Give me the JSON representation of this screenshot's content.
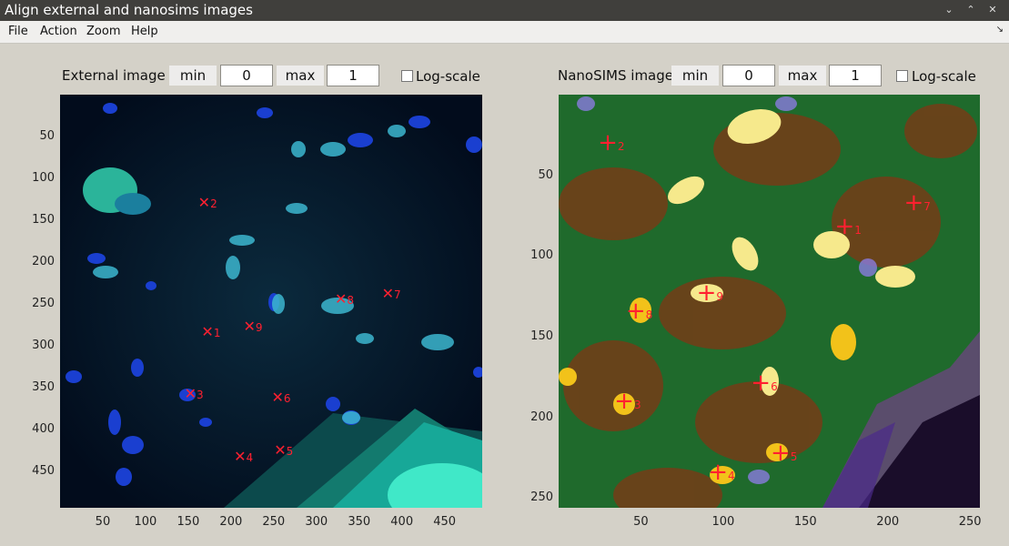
{
  "window": {
    "title": "Align external and nanosims images",
    "buttons": [
      "⌄",
      "⌃",
      "✕"
    ]
  },
  "menu": {
    "items": [
      "File",
      "Action",
      "Zoom",
      "Help"
    ],
    "dock": "↘"
  },
  "external": {
    "label": "External image",
    "min_label": "min",
    "min_value": "0",
    "max_label": "max",
    "max_value": "1",
    "log_label": "Log-scale",
    "yticks": [
      "50",
      "100",
      "150",
      "200",
      "250",
      "300",
      "350",
      "400",
      "450"
    ],
    "xticks": [
      "50",
      "100",
      "150",
      "200",
      "250",
      "300",
      "350",
      "400",
      "450"
    ],
    "markers": [
      {
        "n": "1",
        "x": 174,
        "y": 284
      },
      {
        "n": "2",
        "x": 170,
        "y": 130
      },
      {
        "n": "3",
        "x": 154,
        "y": 358
      },
      {
        "n": "4",
        "x": 212,
        "y": 433
      },
      {
        "n": "5",
        "x": 259,
        "y": 425
      },
      {
        "n": "6",
        "x": 256,
        "y": 362
      },
      {
        "n": "7",
        "x": 385,
        "y": 238
      },
      {
        "n": "8",
        "x": 330,
        "y": 245
      },
      {
        "n": "9",
        "x": 223,
        "y": 278
      }
    ]
  },
  "nanosims": {
    "label": "NanoSIMS image",
    "min_label": "min",
    "min_value": "0",
    "max_label": "max",
    "max_value": "1",
    "log_label": "Log-scale",
    "yticks": [
      "50",
      "100",
      "150",
      "200",
      "250"
    ],
    "xticks": [
      "50",
      "100",
      "150",
      "200",
      "250"
    ],
    "markers": [
      {
        "n": "1",
        "x": 175,
        "y": 82
      },
      {
        "n": "2",
        "x": 31,
        "y": 30
      },
      {
        "n": "3",
        "x": 41,
        "y": 190
      },
      {
        "n": "4",
        "x": 98,
        "y": 234
      },
      {
        "n": "5",
        "x": 136,
        "y": 222
      },
      {
        "n": "6",
        "x": 124,
        "y": 179
      },
      {
        "n": "7",
        "x": 217,
        "y": 67
      },
      {
        "n": "8",
        "x": 48,
        "y": 134
      },
      {
        "n": "9",
        "x": 91,
        "y": 123
      }
    ]
  }
}
